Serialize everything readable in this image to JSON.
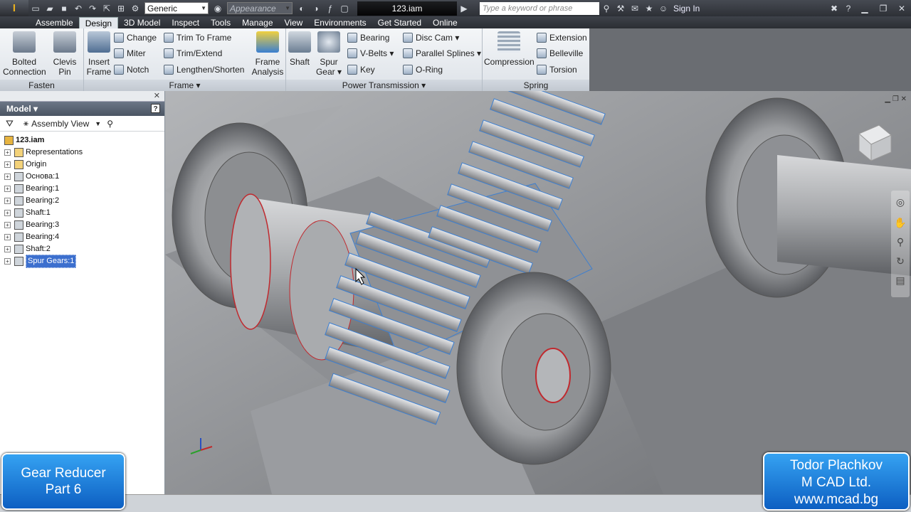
{
  "qat": {
    "logo_sub": "PRO",
    "material_value": "Generic",
    "appearance_value": "Appearance",
    "file_title": "123.iam",
    "search_placeholder": "Type a keyword or phrase",
    "sign_in": "Sign In"
  },
  "tabs": [
    "Assemble",
    "Design",
    "3D Model",
    "Inspect",
    "Tools",
    "Manage",
    "View",
    "Environments",
    "Get Started",
    "Online"
  ],
  "active_tab": "Design",
  "ribbon": {
    "fasten": {
      "label": "Fasten",
      "bolted": "Bolted\nConnection",
      "clevis": "Clevis\nPin"
    },
    "frame": {
      "label": "Frame",
      "insert": "Insert\nFrame",
      "change": "Change",
      "miter": "Miter",
      "notch": "Notch",
      "trim_to_frame": "Trim To Frame",
      "trim_extend": "Trim/Extend",
      "lengthen": "Lengthen/Shorten",
      "analysis": "Frame\nAnalysis"
    },
    "power": {
      "label": "Power Transmission",
      "shaft": "Shaft",
      "spur": "Spur\nGear",
      "bearing": "Bearing",
      "vbelts": "V-Belts",
      "key": "Key",
      "disc_cam": "Disc Cam",
      "parallel_splines": "Parallel Splines",
      "oring": "O-Ring"
    },
    "spring": {
      "label": "Spring",
      "compression": "Compression",
      "extension": "Extension",
      "belleville": "Belleville",
      "torsion": "Torsion"
    }
  },
  "browser": {
    "header": "Model",
    "view": "Assembly View",
    "tree": [
      {
        "label": "123.iam",
        "type": "root"
      },
      {
        "label": "Representations",
        "type": "folder"
      },
      {
        "label": "Origin",
        "type": "folder"
      },
      {
        "label": "Основа:1",
        "type": "part"
      },
      {
        "label": "Bearing:1",
        "type": "part"
      },
      {
        "label": "Bearing:2",
        "type": "part"
      },
      {
        "label": "Shaft:1",
        "type": "part"
      },
      {
        "label": "Bearing:3",
        "type": "part"
      },
      {
        "label": "Bearing:4",
        "type": "part"
      },
      {
        "label": "Shaft:2",
        "type": "part"
      },
      {
        "label": "Spur Gears:1",
        "type": "part",
        "selected": true
      }
    ]
  },
  "overlay_left": {
    "line1": "Gear Reducer",
    "line2": "Part 6"
  },
  "overlay_right": {
    "line1": "Todor Plachkov",
    "line2": "M CAD Ltd.",
    "line3": "www.mcad.bg"
  },
  "colors": {
    "highlight": "#3c6fce",
    "badge": "#1478d8",
    "ribbon": "#e6eaee"
  }
}
